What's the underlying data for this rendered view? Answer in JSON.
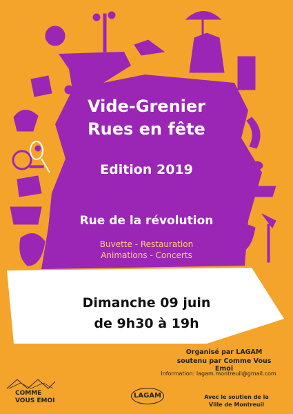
{
  "poster": {
    "title_line1": "Vide-Grenier",
    "title_line2": "Rues en fête",
    "edition": "Edition 2019",
    "street": "Rue de la révolution",
    "services_line1": "Buvette - Restauration",
    "services_line2": "Animations - Concerts",
    "date_line1": "Dimanche 09 juin",
    "date_line2": "de 9h30 à 19h",
    "organizer_line1": "Organisé par LAGAM",
    "organizer_line2": "soutenu par Comme Vous Emoi",
    "information": "Information: lagam.montreuil@gmail.com",
    "support_line1": "Avec le soutien de la",
    "support_line2": "Ville de Montreuil"
  },
  "logos": {
    "comme_vous_emoi": "COMME VOUS EMOI",
    "lagam": "LAGAM"
  },
  "colors": {
    "background": "#f4a42a",
    "shape": "#9c27b0",
    "white_band": "#ffffff",
    "services_text": "#ffd27a"
  }
}
